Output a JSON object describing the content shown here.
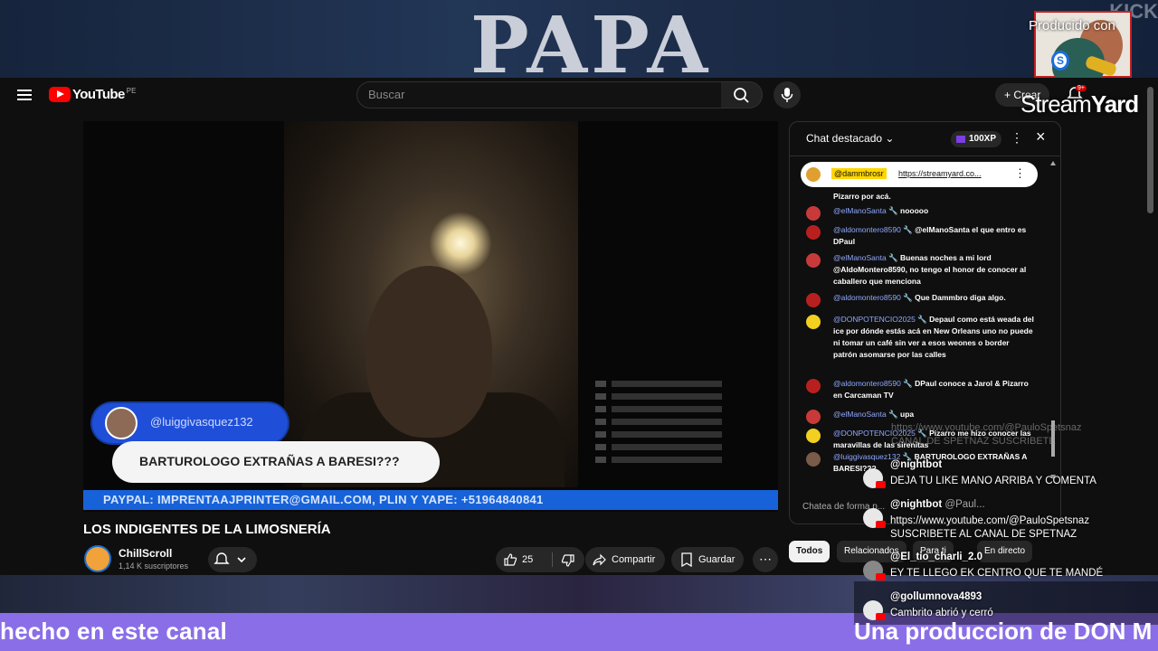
{
  "overlay": {
    "banner_text": "PAPA",
    "kick_text": "KICK",
    "produced_label": "Producido con",
    "s_badge": "S",
    "streamyard_light": "Stream",
    "streamyard_bold": "Yard",
    "ticker_left": "hecho en este canal",
    "ticker_right": "Una produccion de DON M",
    "ghost_link": "https://www.youtube.com/@PauloSpetsnaz",
    "ghost_text": "CANAL DE SPETNAZ SUSCRIBETE",
    "chat": [
      {
        "user": "@nightbot",
        "platform": "",
        "text": "DEJA TU LIKE MANO ARRIBA Y COMENTA"
      },
      {
        "user": "@nightbot",
        "platform": "@Paul...",
        "text": "https://www.youtube.com/@PauloSpetsnaz\nSUSCRIBETE AL CANAL DE SPETNAZ"
      },
      {
        "user": "@El_tio_charli_2.0",
        "platform": "",
        "text": "EY TE LLEGO EK CENTRO QUE TE MANDÉ"
      },
      {
        "user": "@gollumnova4893",
        "platform": "",
        "text": "Cambrito abrió y cerró"
      }
    ]
  },
  "youtube": {
    "logo_text": "YouTube",
    "region": "PE",
    "search_placeholder": "Buscar",
    "create_label": "+ Crear",
    "notif_count": "9+",
    "video": {
      "name_tag": "@luiggivasquez132",
      "message": "BARTUROLOGO EXTRAÑAS A BARESI???",
      "paypal": "PAYPAL: IMPRENTAAJPRINTER@GMAIL.COM, PLIN Y YAPE: +51964840841"
    },
    "title": "LOS INDIGENTES DE LA LIMOSNERÍA",
    "channel": {
      "name": "ChillScroll",
      "subs": "1,14 K suscriptores"
    },
    "likes": "25",
    "share_label": "Compartir",
    "save_label": "Guardar",
    "chat": {
      "title": "Chat destacado",
      "xp": "100XP",
      "pinned_user": "@dammbrosr",
      "pinned_link": "https://streamyard.co...",
      "input_placeholder": "Chatea de forma p...",
      "messages": [
        {
          "user": "",
          "text": "Pizarro por acá."
        },
        {
          "user": "@elManoSanta",
          "text": "nooooo"
        },
        {
          "user": "@aldomontero8590",
          "text": "@elManoSanta el que entro es DPaul"
        },
        {
          "user": "@elManoSanta",
          "text": "Buenas noches a mi lord @AldoMontero8590, no tengo el honor de conocer al caballero que menciona"
        },
        {
          "user": "@aldomontero8590",
          "text": "Que Dammbro diga algo."
        },
        {
          "user": "@DONPOTENCIO2025",
          "text": "Depaul como está weada del ice por dónde estás acá en New Orleans uno no puede ni tomar un café sin ver a esos weones o border patrón asomarse por las calles"
        },
        {
          "user": "@aldomontero8590",
          "text": "DPaul conoce a Jarol & Pizarro en Carcaman TV"
        },
        {
          "user": "@elManoSanta",
          "text": "upa"
        },
        {
          "user": "@DONPOTENCIO2025",
          "text": "Pizarro me hizo conocer las maravillas de las sirenitas"
        },
        {
          "user": "@luiggivasquez132",
          "text": "BARTUROLOGO EXTRAÑAS A BARESI???"
        }
      ]
    },
    "tabs": [
      "Todos",
      "Relacionados",
      "Para ti",
      "En directo"
    ]
  }
}
